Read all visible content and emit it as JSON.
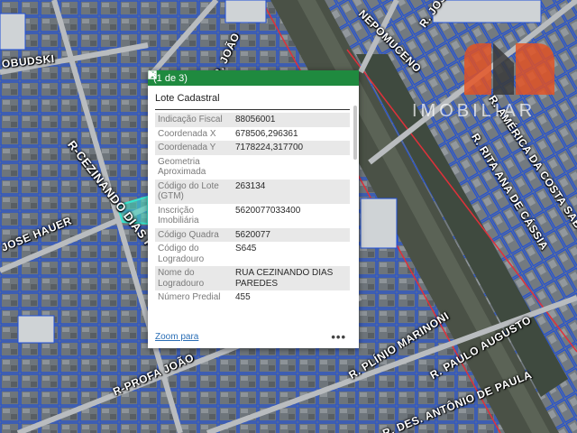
{
  "map": {
    "streets": [
      {
        "name": "R-CEZINANDO DIAS PAREDES"
      },
      {
        "name": "R. JOÃO"
      },
      {
        "name": "OBUDSKI"
      },
      {
        "name": "JOSE HAUER"
      },
      {
        "name": "R-PROFA JOÃO"
      },
      {
        "name": "R. PLÍNIO MARINONI"
      },
      {
        "name": "R. PAULO AUGUSTO"
      },
      {
        "name": "R. DES. ANTÔNIO DE PAULA"
      },
      {
        "name": "R. RITA ANA DE CÁSSIA"
      },
      {
        "name": "R. AMÉRICA DA COSTA SABO"
      },
      {
        "name": "NEPOMUCENO"
      },
      {
        "name": "R. JOSE"
      }
    ],
    "watermark": {
      "text": "IMOBILIAR",
      "colors": {
        "orange": "#e8501e",
        "gray": "#3a3a3a"
      }
    }
  },
  "popup": {
    "counter": "(1 de 3)",
    "title": "Lote Cadastral",
    "attributes": [
      {
        "key": "Indicação Fiscal",
        "value": "88056001"
      },
      {
        "key": "Coordenada X",
        "value": "678506,296361"
      },
      {
        "key": "Coordenada Y",
        "value": "7178224,317700"
      },
      {
        "key": "Geometria Aproximada",
        "value": ""
      },
      {
        "key": "Código do Lote (GTM)",
        "value": "263134"
      },
      {
        "key": "Inscrição Imobiliária",
        "value": "5620077033400"
      },
      {
        "key": "Código Quadra",
        "value": "5620077"
      },
      {
        "key": "Código do Logradouro",
        "value": "S645"
      },
      {
        "key": "Nome do Logradouro",
        "value": "RUA CEZINANDO DIAS PAREDES"
      },
      {
        "key": "Número Predial",
        "value": "455"
      }
    ],
    "zoom_label": "Zoom para",
    "more_label": "•••",
    "icons": {
      "next": "play-icon",
      "maximize": "maximize-icon",
      "close": "close-icon",
      "more": "more-icon"
    },
    "colors": {
      "header": "#1f8a3f",
      "link": "#2a6eb5"
    }
  }
}
